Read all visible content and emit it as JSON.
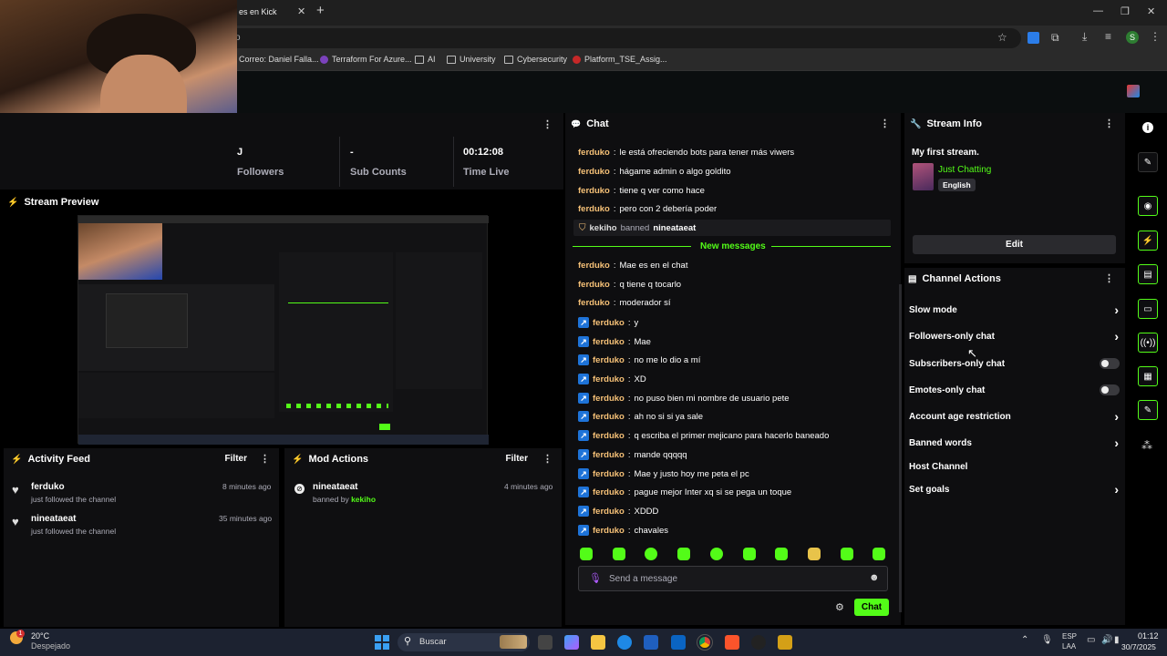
{
  "browser": {
    "tab_title": "es en Kick",
    "new_tab": "+",
    "window_controls": [
      "—",
      "❐",
      "✕"
    ],
    "url_fragment": "o",
    "bookmarks": [
      "Correo: Daniel Falla...",
      "Terraform For Azure...",
      "AI",
      "University",
      "Cybersecurity",
      "Platform_TSE_Assig..."
    ],
    "profile_initial": "S"
  },
  "stats": {
    "followers_value": "J",
    "followers_label": "Followers",
    "subs_value": "-",
    "subs_label": "Sub Counts",
    "time_value": "00:12:08",
    "time_label": "Time Live"
  },
  "stream_preview": {
    "title": "Stream Preview"
  },
  "activity_feed": {
    "title": "Activity Feed",
    "filter": "Filter",
    "items": [
      {
        "user": "ferduko",
        "action": "just followed the channel",
        "time": "8 minutes ago"
      },
      {
        "user": "nineataeat",
        "action": "just followed the channel",
        "time": "35 minutes ago"
      }
    ]
  },
  "mod_actions": {
    "title": "Mod Actions",
    "filter": "Filter",
    "items": [
      {
        "user": "nineataeat",
        "action_prefix": "banned by",
        "moderator": "kekiho",
        "time": "4 minutes ago"
      }
    ]
  },
  "chat": {
    "title": "Chat",
    "old_messages": [
      {
        "user": "ferduko",
        "text": "le está ofreciendo bots para tener más viwers"
      },
      {
        "user": "ferduko",
        "text": "hágame admin o algo goldito"
      },
      {
        "user": "ferduko",
        "text": "tiene q ver como hace"
      },
      {
        "user": "ferduko",
        "text": "pero con 2 debería poder"
      }
    ],
    "ban_notice": {
      "moderator": "kekiho",
      "verb": "banned",
      "target": "nineataeat"
    },
    "new_messages_label": "New messages",
    "new_messages": [
      {
        "user": "ferduko",
        "text": "Mae es en el chat",
        "badge": false
      },
      {
        "user": "ferduko",
        "text": "q tiene q tocarlo",
        "badge": false
      },
      {
        "user": "ferduko",
        "text": "moderador sí",
        "badge": false
      },
      {
        "user": "ferduko",
        "text": "y",
        "badge": true
      },
      {
        "user": "ferduko",
        "text": "Mae",
        "badge": true
      },
      {
        "user": "ferduko",
        "text": "no me lo dio a mí",
        "badge": true
      },
      {
        "user": "ferduko",
        "text": "XD",
        "badge": true
      },
      {
        "user": "ferduko",
        "text": "no puso bien mi nombre de usuario pete",
        "badge": true
      },
      {
        "user": "ferduko",
        "text": "ah no si si ya sale",
        "badge": true
      },
      {
        "user": "ferduko",
        "text": "q escriba el primer mejicano para hacerlo baneado",
        "badge": true
      },
      {
        "user": "ferduko",
        "text": "mande qqqqq",
        "badge": true
      },
      {
        "user": "ferduko",
        "text": "Mae y justo hoy me peta el pc",
        "badge": true
      },
      {
        "user": "ferduko",
        "text": "pague mejor Inter xq si se pega un toque",
        "badge": true
      },
      {
        "user": "ferduko",
        "text": "XDDD",
        "badge": true
      },
      {
        "user": "ferduko",
        "text": "chavales",
        "badge": true
      }
    ],
    "input_placeholder": "Send a message",
    "send_label": "Chat"
  },
  "stream_info": {
    "title": "Stream Info",
    "stream_title": "My first stream.",
    "category": "Just Chatting",
    "language": "English",
    "edit_label": "Edit"
  },
  "channel_actions": {
    "title": "Channel Actions",
    "items": [
      {
        "label": "Slow mode",
        "control": "chevron"
      },
      {
        "label": "Followers-only chat",
        "control": "chevron"
      },
      {
        "label": "Subscribers-only chat",
        "control": "toggle"
      },
      {
        "label": "Emotes-only chat",
        "control": "toggle"
      },
      {
        "label": "Account age restriction",
        "control": "chevron"
      },
      {
        "label": "Banned words",
        "control": "chevron"
      },
      {
        "label": "Host Channel",
        "control": "none"
      },
      {
        "label": "Set goals",
        "control": "chevron"
      }
    ]
  },
  "taskbar": {
    "weather_temp": "20°C",
    "weather_desc": "Despejado",
    "search_placeholder": "Buscar",
    "lang_top": "ESP",
    "lang_bottom": "LAA",
    "time": "01:12",
    "date": "30/7/2025"
  },
  "colors": {
    "accent": "#53fc18",
    "username": "#f6c177",
    "panel": "#0e0e10"
  }
}
